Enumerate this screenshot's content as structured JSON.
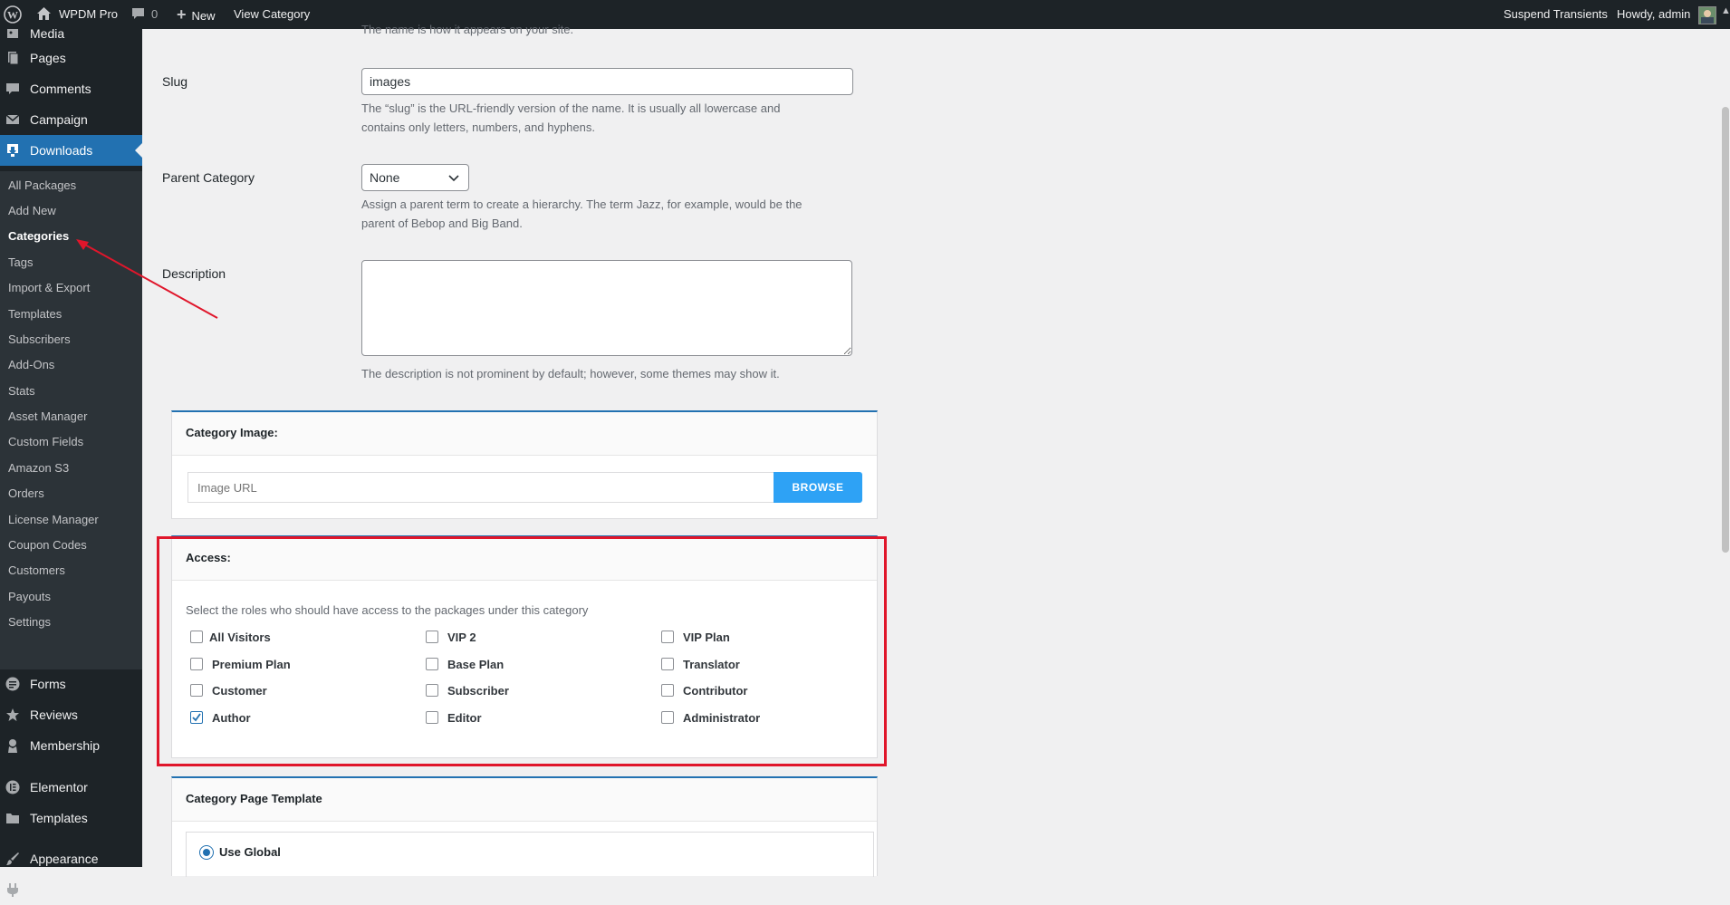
{
  "admin_bar": {
    "site_name": "WPDM Pro",
    "comments_count": "0",
    "new_label": "New",
    "view_category_label": "View Category",
    "suspend_transients_label": "Suspend Transients",
    "howdy_label": "Howdy, admin"
  },
  "sidebar": {
    "top_items": [
      {
        "label": "Media",
        "icon": "media-icon"
      },
      {
        "label": "Pages",
        "icon": "pages-icon"
      },
      {
        "label": "Comments",
        "icon": "comments-icon"
      },
      {
        "label": "Campaign",
        "icon": "mail-icon"
      },
      {
        "label": "Downloads",
        "icon": "download-icon"
      }
    ],
    "sub_items": [
      "All Packages",
      "Add New",
      "Categories",
      "Tags",
      "Import & Export",
      "Templates",
      "Subscribers",
      "Add-Ons",
      "Stats",
      "Asset Manager",
      "Custom Fields",
      "Amazon S3",
      "Orders",
      "License Manager",
      "Coupon Codes",
      "Customers",
      "Payouts",
      "Settings"
    ],
    "bottom_items": [
      {
        "label": "Forms",
        "icon": "forms-icon"
      },
      {
        "label": "Reviews",
        "icon": "star-icon"
      },
      {
        "label": "Membership",
        "icon": "membership-icon"
      },
      {
        "label": "Elementor",
        "icon": "elementor-icon"
      },
      {
        "label": "Templates",
        "icon": "folder-icon"
      },
      {
        "label": "Appearance",
        "icon": "brush-icon"
      },
      {
        "label": "Plugins",
        "icon": "plugin-icon"
      }
    ]
  },
  "form": {
    "name_help": "The name is how it appears on your site.",
    "slug_label": "Slug",
    "slug_value": "images",
    "slug_help_1": "The “slug” is the URL-friendly version of the name. It is usually all lowercase and",
    "slug_help_2": "contains only letters, numbers, and hyphens.",
    "parent_label": "Parent Category",
    "parent_value": "None",
    "parent_help_1": "Assign a parent term to create a hierarchy. The term Jazz, for example, would be the",
    "parent_help_2": "parent of Bebop and Big Band.",
    "description_label": "Description",
    "description_value": "",
    "description_help": "The description is not prominent by default; however, some themes may show it."
  },
  "category_image": {
    "title": "Category Image:",
    "placeholder": "Image URL",
    "browse_label": "BROWSE"
  },
  "access": {
    "title": "Access:",
    "instruction": "Select the roles who should have access to the packages under this category",
    "roles": [
      {
        "label": "All Visitors",
        "checked": false
      },
      {
        "label": "VIP 2",
        "checked": false
      },
      {
        "label": "VIP Plan",
        "checked": false
      },
      {
        "label": "Premium Plan",
        "checked": false
      },
      {
        "label": "Base Plan",
        "checked": false
      },
      {
        "label": "Translator",
        "checked": false
      },
      {
        "label": "Customer",
        "checked": false
      },
      {
        "label": "Subscriber",
        "checked": false
      },
      {
        "label": "Contributor",
        "checked": false
      },
      {
        "label": "Author",
        "checked": true
      },
      {
        "label": "Editor",
        "checked": false
      },
      {
        "label": "Administrator",
        "checked": false
      }
    ]
  },
  "page_template": {
    "title": "Category Page Template",
    "option_label": "Use Global"
  },
  "colors": {
    "admin_bg": "#1d2327",
    "accent": "#2271b1",
    "browse": "#2ea2f5",
    "highlight": "#e0162b"
  }
}
